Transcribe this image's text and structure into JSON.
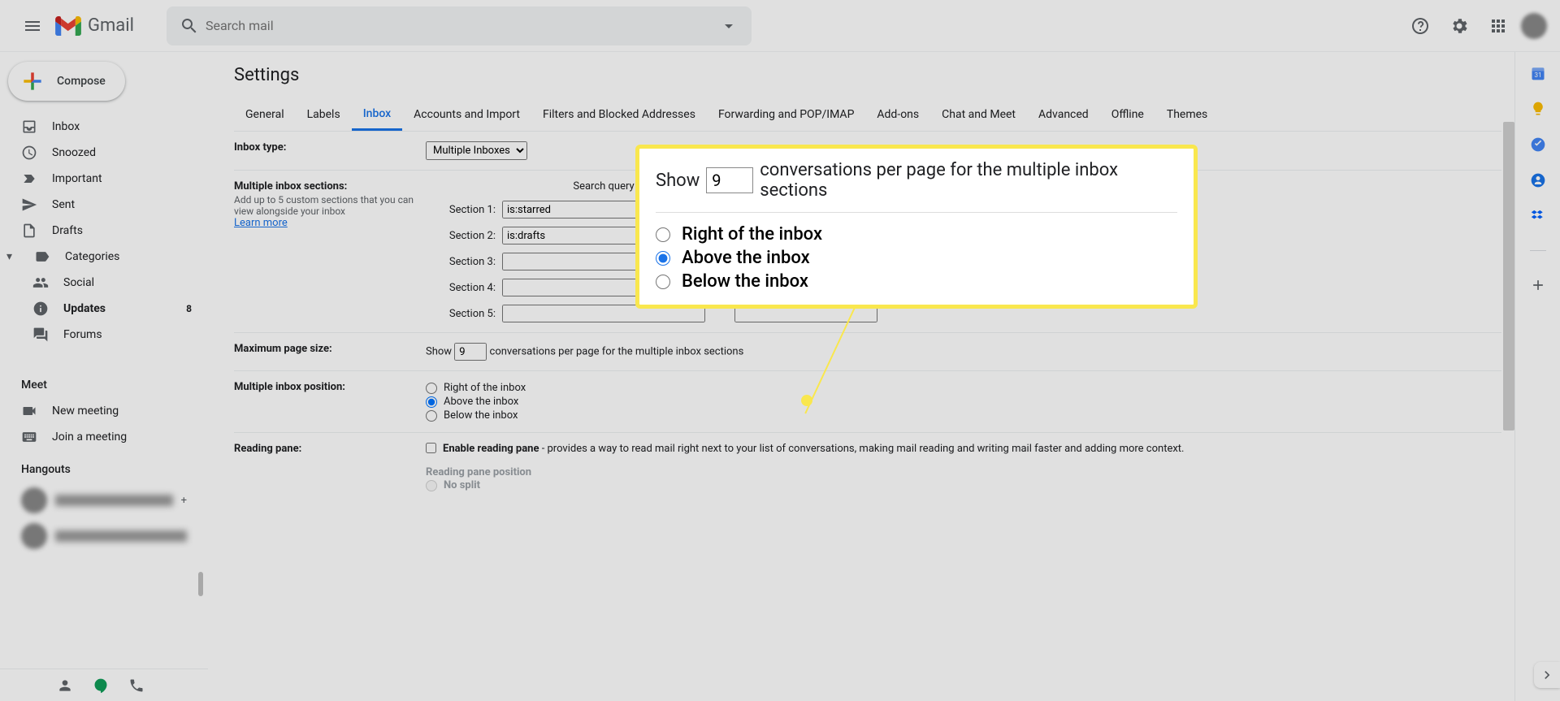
{
  "header": {
    "app_name": "Gmail",
    "search_placeholder": "Search mail"
  },
  "compose": "Compose",
  "nav": {
    "inbox": "Inbox",
    "snoozed": "Snoozed",
    "important": "Important",
    "sent": "Sent",
    "drafts": "Drafts",
    "categories": "Categories",
    "social": "Social",
    "updates": "Updates",
    "updates_count": "8",
    "forums": "Forums"
  },
  "meet": {
    "title": "Meet",
    "new": "New meeting",
    "join": "Join a meeting"
  },
  "hangouts": {
    "title": "Hangouts"
  },
  "settings": {
    "title": "Settings",
    "tabs": {
      "general": "General",
      "labels": "Labels",
      "inbox": "Inbox",
      "accounts": "Accounts and Import",
      "filters": "Filters and Blocked Addresses",
      "forwarding": "Forwarding and POP/IMAP",
      "addons": "Add-ons",
      "chat": "Chat and Meet",
      "advanced": "Advanced",
      "offline": "Offline",
      "themes": "Themes"
    },
    "inbox_type": {
      "label": "Inbox type:",
      "value": "Multiple Inboxes"
    },
    "sections": {
      "label": "Multiple inbox sections:",
      "sub": "Add up to 5 custom sections that you can view alongside your inbox",
      "learn": "Learn more",
      "query_hdr": "Search query",
      "s1": "Section 1:",
      "s1v": "is:starred",
      "s2": "Section 2:",
      "s2v": "is:drafts",
      "s3": "Section 3:",
      "s4": "Section 4:",
      "s5": "Section 5:"
    },
    "page_size": {
      "label": "Maximum page size:",
      "pre": "Show",
      "value": "9",
      "post": "conversations per page for the multiple inbox sections"
    },
    "position": {
      "label": "Multiple inbox position:",
      "right": "Right of the inbox",
      "above": "Above the inbox",
      "below": "Below the inbox"
    },
    "reading": {
      "label": "Reading pane:",
      "enable": "Enable reading pane",
      "desc": " - provides a way to read mail right next to your list of conversations, making mail reading and writing mail faster and adding more context.",
      "pos_label": "Reading pane position",
      "nosplit": "No split"
    }
  },
  "callout": {
    "pre": "Show",
    "value": "9",
    "post": "conversations per page for the multiple inbox sections",
    "right": "Right of the inbox",
    "above": "Above the inbox",
    "below": "Below the inbox"
  }
}
